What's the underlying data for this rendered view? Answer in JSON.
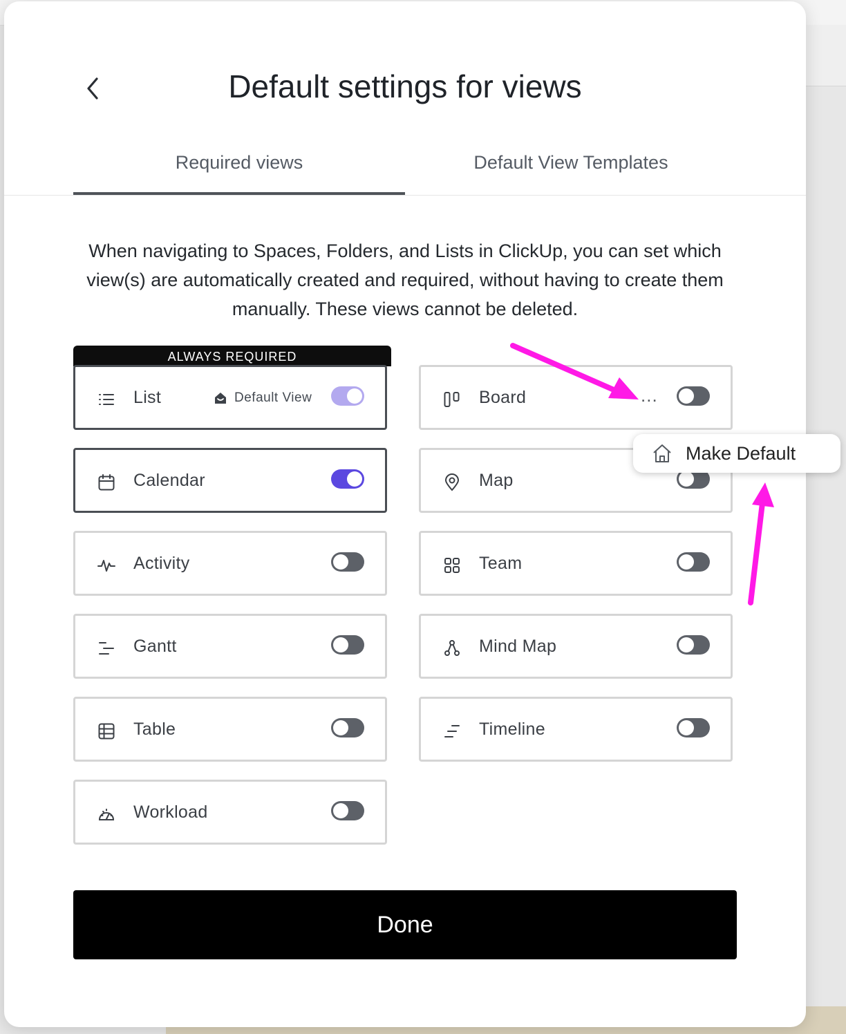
{
  "modal": {
    "title": "Default settings for views",
    "tabs": [
      {
        "label": "Required views",
        "active": true
      },
      {
        "label": "Default View Templates",
        "active": false
      }
    ],
    "description": "When navigating to Spaces, Folders, and Lists in ClickUp, you can set which view(s) are automatically created and required, without having to create them manually. These views cannot be deleted.",
    "always_required_label": "ALWAYS REQUIRED",
    "default_view_label": "Default View",
    "done_label": "Done"
  },
  "views": {
    "list": {
      "label": "List",
      "icon": "list-icon",
      "enabled": true,
      "disabled": true,
      "default": true
    },
    "calendar": {
      "label": "Calendar",
      "icon": "calendar-icon",
      "enabled": true
    },
    "activity": {
      "label": "Activity",
      "icon": "activity-icon",
      "enabled": false
    },
    "gantt": {
      "label": "Gantt",
      "icon": "gantt-icon",
      "enabled": false
    },
    "table": {
      "label": "Table",
      "icon": "table-icon",
      "enabled": false
    },
    "workload": {
      "label": "Workload",
      "icon": "workload-icon",
      "enabled": false
    },
    "board": {
      "label": "Board",
      "icon": "board-icon",
      "enabled": false,
      "more_menu": "..."
    },
    "map": {
      "label": "Map",
      "icon": "map-pin-icon",
      "enabled": false
    },
    "team": {
      "label": "Team",
      "icon": "team-icon",
      "enabled": false
    },
    "mindmap": {
      "label": "Mind Map",
      "icon": "mind-map-icon",
      "enabled": false
    },
    "timeline": {
      "label": "Timeline",
      "icon": "timeline-icon",
      "enabled": false
    }
  },
  "popover": {
    "label": "Make Default",
    "icon": "home-icon"
  },
  "colors": {
    "toggle_on": "#5b48e0",
    "toggle_on_disabled": "#b3a9ef",
    "toggle_off": "#5d6168",
    "annotation_arrow": "#ff19e6"
  }
}
